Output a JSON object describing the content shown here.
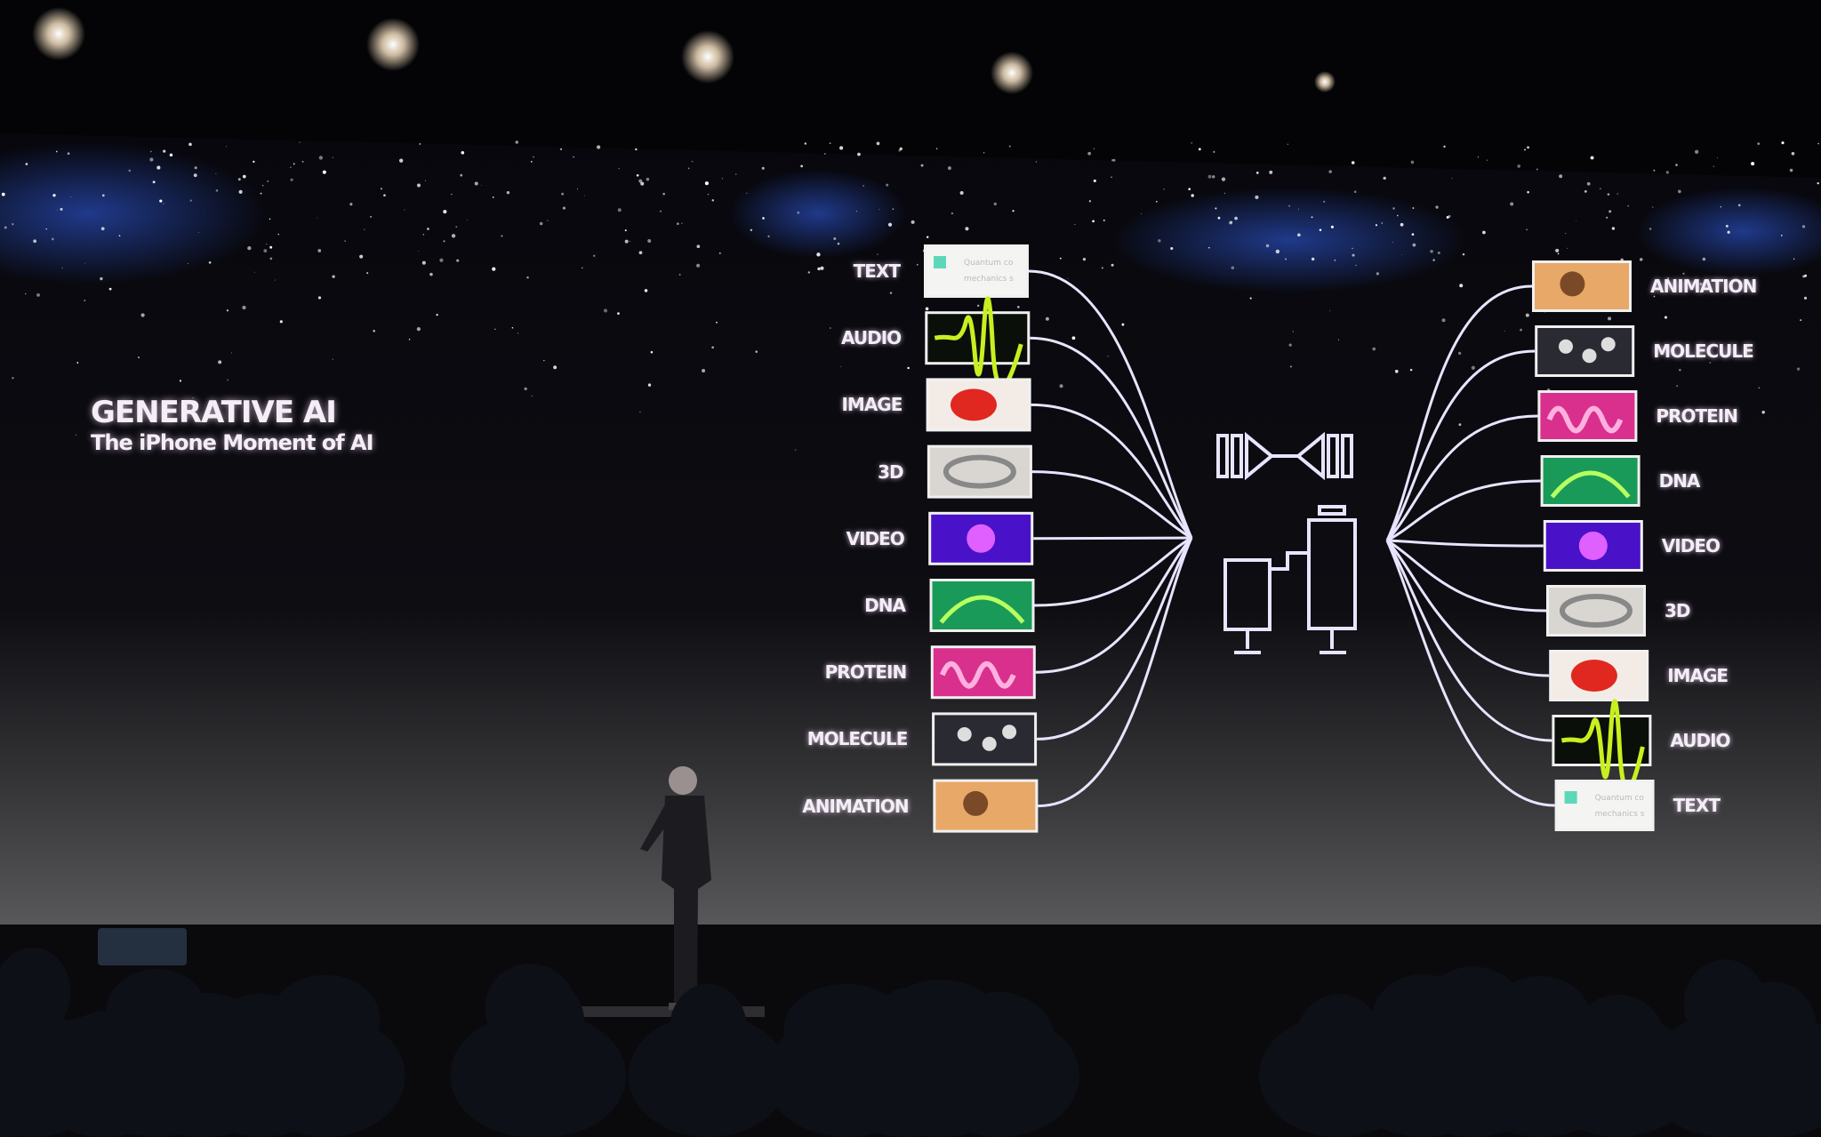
{
  "slide": {
    "title": "GENERATIVE AI",
    "subtitle": "The iPhone Moment of AI",
    "inputs": [
      "TEXT",
      "AUDIO",
      "IMAGE",
      "3D",
      "VIDEO",
      "DNA",
      "PROTEIN",
      "MOLECULE",
      "ANIMATION"
    ],
    "outputs": [
      "ANIMATION",
      "MOLECULE",
      "PROTEIN",
      "DNA",
      "VIDEO",
      "3D",
      "IMAGE",
      "AUDIO",
      "TEXT"
    ],
    "text_thumbnail_lines": [
      "Quantum co",
      "mechanics s"
    ],
    "colors": {
      "TEXT": "#f4f4f2",
      "AUDIO": "#0b0f0a",
      "IMAGE": "#f3ece6",
      "3D": "#d9d6d2",
      "VIDEO": "#4a12c8",
      "DNA": "#1a9a58",
      "PROTEIN": "#d8308c",
      "MOLECULE": "#2a2a33",
      "ANIMATION": "#e8a868",
      "connector": "#e8e4ff"
    }
  }
}
